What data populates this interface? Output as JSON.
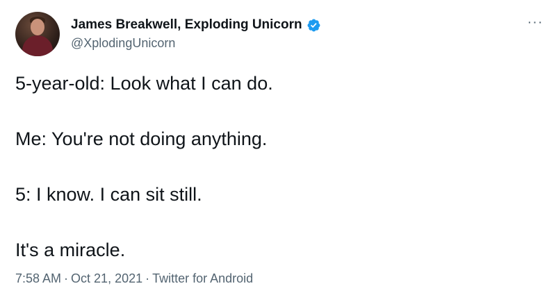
{
  "author": {
    "display_name": "James Breakwell, Exploding Unicorn",
    "handle": "@XplodingUnicorn",
    "verified": true,
    "verified_icon": "verified-badge-icon"
  },
  "more_icon": "more-icon",
  "more_glyph": "···",
  "tweet": {
    "lines": [
      "5-year-old: Look what I can do.",
      "Me: You're not doing anything.",
      "5: I know. I can sit still.",
      "It's a miracle."
    ]
  },
  "meta": {
    "time": "7:58 AM",
    "separator": "·",
    "date": "Oct 21, 2021",
    "source": "Twitter for Android"
  },
  "colors": {
    "text": "#0f1419",
    "secondary": "#536471",
    "verified": "#1d9bf0",
    "background": "#ffffff"
  }
}
